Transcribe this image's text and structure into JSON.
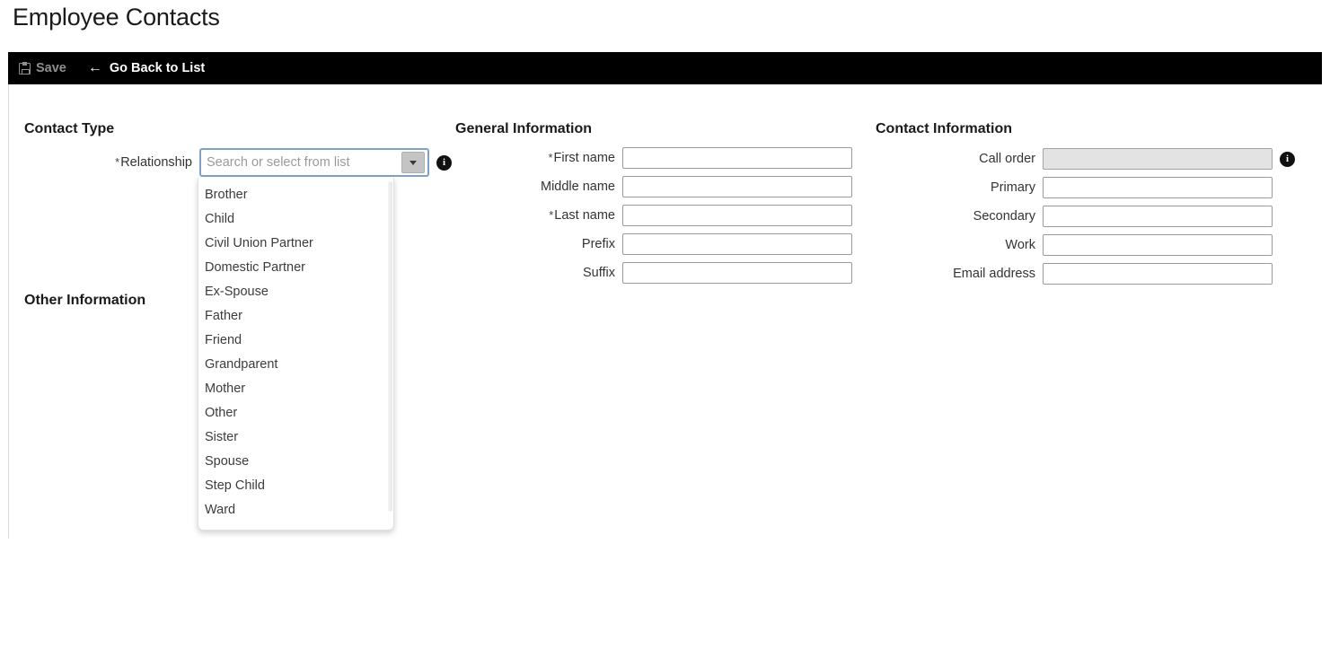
{
  "page": {
    "title": "Employee Contacts"
  },
  "toolbar": {
    "save_label": "Save",
    "save_icon": "save-disk-icon",
    "back_label": "Go Back to List",
    "back_icon": "left-arrow-icon"
  },
  "sections": {
    "contact_type": {
      "heading": "Contact Type",
      "relationship": {
        "label": "Relationship",
        "required_marker": "*",
        "value": "",
        "placeholder": "Search or select from list",
        "caret_icon": "chevron-down-icon",
        "info_icon": "info-icon",
        "info_glyph": "i",
        "options": [
          "Brother",
          "Child",
          "Civil Union Partner",
          "Domestic Partner",
          "Ex-Spouse",
          "Father",
          "Friend",
          "Grandparent",
          "Mother",
          "Other",
          "Sister",
          "Spouse",
          "Step Child",
          "Ward"
        ]
      }
    },
    "other_information": {
      "heading": "Other Information"
    },
    "general_information": {
      "heading": "General Information",
      "fields": [
        {
          "label": "First name",
          "required_marker": "*",
          "value": "",
          "disabled": false
        },
        {
          "label": "Middle name",
          "required_marker": "",
          "value": "",
          "disabled": false
        },
        {
          "label": "Last name",
          "required_marker": "*",
          "value": "",
          "disabled": false
        },
        {
          "label": "Prefix",
          "required_marker": "",
          "value": "",
          "disabled": false
        },
        {
          "label": "Suffix",
          "required_marker": "",
          "value": "",
          "disabled": false
        }
      ]
    },
    "contact_information": {
      "heading": "Contact Information",
      "fields": [
        {
          "label": "Call order",
          "required_marker": "",
          "value": "",
          "disabled": true,
          "info": true
        },
        {
          "label": "Primary",
          "required_marker": "",
          "value": "",
          "disabled": false,
          "info": false
        },
        {
          "label": "Secondary",
          "required_marker": "",
          "value": "",
          "disabled": false,
          "info": false
        },
        {
          "label": "Work",
          "required_marker": "",
          "value": "",
          "disabled": false,
          "info": false
        },
        {
          "label": "Email address",
          "required_marker": "",
          "value": "",
          "disabled": false,
          "info": false
        }
      ]
    }
  },
  "colors": {
    "toolbar_bg": "#000000",
    "focus_border": "#7fa2c4",
    "disabled_field": "#e3e3e3",
    "info_icon_bg": "#111111"
  }
}
